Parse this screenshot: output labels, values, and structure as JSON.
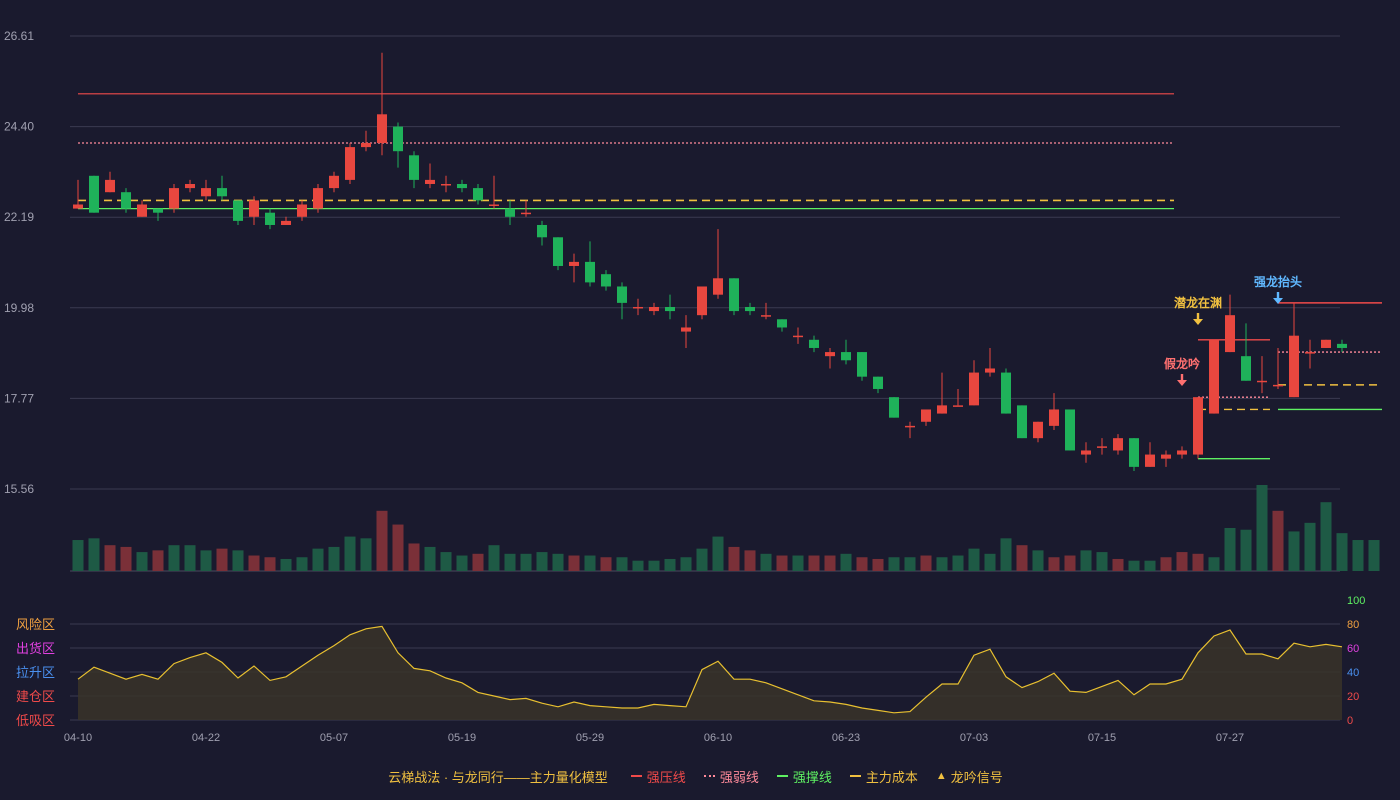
{
  "chart_data": {
    "type": "candlestick",
    "price_axis": {
      "ticks": [
        "26.61",
        "24.40",
        "22.19",
        "19.98",
        "17.77",
        "15.56"
      ],
      "ylim": [
        15.56,
        26.61
      ]
    },
    "x_ticks": [
      {
        "index": 0,
        "label": "04-10"
      },
      {
        "index": 8,
        "label": "04-22"
      },
      {
        "index": 16,
        "label": "05-07"
      },
      {
        "index": 24,
        "label": "05-19"
      },
      {
        "index": 32,
        "label": "05-29"
      },
      {
        "index": 40,
        "label": "06-10"
      },
      {
        "index": 48,
        "label": "06-23"
      },
      {
        "index": 56,
        "label": "07-03"
      },
      {
        "index": 64,
        "label": "07-15"
      },
      {
        "index": 72,
        "label": "07-27"
      }
    ],
    "candles": [
      [
        22.4,
        22.5,
        23.1,
        22.4
      ],
      [
        23.2,
        22.3,
        23.2,
        22.3
      ],
      [
        22.8,
        23.1,
        23.3,
        22.8
      ],
      [
        22.8,
        22.4,
        22.9,
        22.3
      ],
      [
        22.2,
        22.5,
        22.6,
        22.2
      ],
      [
        22.4,
        22.3,
        22.4,
        22.1
      ],
      [
        22.4,
        22.9,
        23.0,
        22.3
      ],
      [
        22.9,
        23.0,
        23.1,
        22.8
      ],
      [
        22.7,
        22.9,
        23.1,
        22.6
      ],
      [
        22.9,
        22.7,
        23.2,
        22.6
      ],
      [
        22.6,
        22.1,
        22.6,
        22.0
      ],
      [
        22.2,
        22.6,
        22.7,
        22.0
      ],
      [
        22.3,
        22.0,
        22.4,
        21.9
      ],
      [
        22.0,
        22.1,
        22.2,
        22.0
      ],
      [
        22.2,
        22.5,
        22.6,
        22.1
      ],
      [
        22.4,
        22.9,
        23.0,
        22.3
      ],
      [
        22.9,
        23.2,
        23.3,
        22.8
      ],
      [
        23.1,
        23.9,
        24.0,
        23.0
      ],
      [
        23.9,
        24.0,
        24.3,
        23.8
      ],
      [
        24.0,
        24.7,
        26.2,
        23.7
      ],
      [
        24.4,
        23.8,
        24.5,
        23.4
      ],
      [
        23.7,
        23.1,
        23.8,
        22.9
      ],
      [
        23.0,
        23.1,
        23.5,
        22.9
      ],
      [
        23.0,
        23.0,
        23.2,
        22.8
      ],
      [
        23.0,
        22.9,
        23.1,
        22.8
      ],
      [
        22.9,
        22.6,
        23.0,
        22.5
      ],
      [
        22.5,
        22.5,
        23.2,
        22.4
      ],
      [
        22.4,
        22.2,
        22.6,
        22.0
      ],
      [
        22.3,
        22.3,
        22.6,
        22.2
      ],
      [
        22.0,
        21.7,
        22.1,
        21.5
      ],
      [
        21.7,
        21.0,
        21.7,
        20.9
      ],
      [
        21.0,
        21.1,
        21.3,
        20.6
      ],
      [
        21.1,
        20.6,
        21.6,
        20.5
      ],
      [
        20.8,
        20.5,
        20.9,
        20.4
      ],
      [
        20.5,
        20.1,
        20.6,
        19.7
      ],
      [
        20.0,
        20.0,
        20.2,
        19.8
      ],
      [
        19.9,
        20.0,
        20.1,
        19.8
      ],
      [
        20.0,
        19.9,
        20.3,
        19.7
      ],
      [
        19.4,
        19.5,
        19.8,
        19.0
      ],
      [
        19.8,
        20.5,
        20.5,
        19.7
      ],
      [
        20.3,
        20.7,
        21.9,
        20.2
      ],
      [
        20.7,
        19.9,
        20.7,
        19.8
      ],
      [
        20.0,
        19.9,
        20.1,
        19.8
      ],
      [
        19.8,
        19.8,
        20.1,
        19.7
      ],
      [
        19.7,
        19.5,
        19.7,
        19.4
      ],
      [
        19.3,
        19.3,
        19.5,
        19.1
      ],
      [
        19.2,
        19.0,
        19.3,
        18.9
      ],
      [
        18.8,
        18.9,
        19.0,
        18.5
      ],
      [
        18.9,
        18.7,
        19.2,
        18.6
      ],
      [
        18.9,
        18.3,
        18.9,
        18.2
      ],
      [
        18.3,
        18.0,
        18.3,
        17.9
      ],
      [
        17.8,
        17.3,
        17.8,
        17.3
      ],
      [
        17.1,
        17.1,
        17.2,
        16.8
      ],
      [
        17.2,
        17.5,
        17.5,
        17.1
      ],
      [
        17.4,
        17.6,
        18.4,
        17.4
      ],
      [
        17.6,
        17.6,
        18.0,
        17.6
      ],
      [
        17.6,
        18.4,
        18.7,
        17.6
      ],
      [
        18.4,
        18.5,
        19.0,
        18.3
      ],
      [
        18.4,
        17.4,
        18.5,
        17.4
      ],
      [
        17.6,
        16.8,
        17.6,
        16.8
      ],
      [
        16.8,
        17.2,
        17.2,
        16.7
      ],
      [
        17.1,
        17.5,
        17.9,
        17.0
      ],
      [
        17.5,
        16.5,
        17.5,
        16.5
      ],
      [
        16.4,
        16.5,
        16.7,
        16.2
      ],
      [
        16.6,
        16.6,
        16.8,
        16.4
      ],
      [
        16.5,
        16.8,
        16.9,
        16.4
      ],
      [
        16.8,
        16.1,
        16.8,
        16.0
      ],
      [
        16.1,
        16.4,
        16.7,
        16.1
      ],
      [
        16.3,
        16.4,
        16.5,
        16.1
      ],
      [
        16.4,
        16.5,
        16.6,
        16.3
      ],
      [
        16.4,
        17.8,
        17.8,
        16.3
      ],
      [
        17.4,
        19.2,
        19.2,
        17.4
      ],
      [
        18.9,
        19.8,
        20.3,
        18.9
      ],
      [
        18.8,
        18.2,
        19.6,
        18.2
      ],
      [
        18.2,
        18.2,
        18.8,
        17.9
      ],
      [
        18.1,
        18.1,
        19.0,
        18.0
      ],
      [
        17.8,
        19.3,
        20.1,
        17.8
      ],
      [
        18.9,
        18.9,
        19.2,
        18.5
      ],
      [
        19.0,
        19.2,
        19.2,
        19.0
      ],
      [
        19.1,
        19.0,
        19.2,
        18.9
      ]
    ],
    "volume": [
      18,
      19,
      15,
      14,
      11,
      12,
      15,
      15,
      12,
      13,
      12,
      9,
      8,
      7,
      8,
      13,
      14,
      20,
      19,
      35,
      27,
      16,
      14,
      11,
      9,
      10,
      15,
      10,
      10,
      11,
      10,
      9,
      9,
      8,
      8,
      6,
      6,
      7,
      8,
      13,
      20,
      14,
      12,
      10,
      9,
      9,
      9,
      9,
      10,
      8,
      7,
      8,
      8,
      9,
      8,
      9,
      13,
      10,
      19,
      15,
      12,
      8,
      9,
      12,
      11,
      7,
      6,
      6,
      8,
      11,
      10,
      8,
      25,
      24,
      50,
      35,
      23,
      28,
      40,
      22,
      18,
      18
    ],
    "volume_up": [
      false,
      false,
      true,
      true,
      false,
      true,
      false,
      false,
      false,
      true,
      false,
      true,
      true,
      false,
      false,
      false,
      false,
      false,
      false,
      true,
      true,
      true,
      false,
      false,
      false,
      true,
      false,
      false,
      false,
      false,
      false,
      true,
      false,
      true,
      false,
      false,
      false,
      false,
      false,
      false,
      false,
      true,
      true,
      false,
      true,
      false,
      true,
      true,
      false,
      true,
      true,
      false,
      false,
      true,
      false,
      false,
      false,
      false,
      false,
      true,
      false,
      true,
      true,
      false,
      false,
      true,
      false,
      false,
      true,
      true,
      true,
      false,
      false,
      false,
      false,
      true,
      false,
      false,
      false,
      false,
      false,
      false
    ],
    "indicator": {
      "name": "龙吟",
      "ylim": [
        0,
        100
      ],
      "right_ticks": [
        "100",
        "80",
        "60",
        "40",
        "20",
        "0"
      ],
      "zones": [
        "风险区",
        "出货区",
        "拉升区",
        "建仓区",
        "低吸区"
      ],
      "values": [
        34,
        44,
        39,
        34,
        38,
        34,
        47,
        52,
        56,
        48,
        35,
        45,
        33,
        36,
        45,
        54,
        62,
        71,
        76,
        78,
        56,
        43,
        41,
        35,
        31,
        23,
        20,
        17,
        18,
        14,
        11,
        15,
        12,
        11,
        10,
        10,
        13,
        12,
        11,
        42,
        49,
        34,
        34,
        31,
        26,
        21,
        16,
        15,
        13,
        10,
        8,
        6,
        7,
        19,
        30,
        30,
        54,
        59,
        36,
        27,
        32,
        39,
        24,
        23,
        28,
        33,
        21,
        30,
        30,
        34,
        56,
        70,
        75,
        55,
        55,
        51,
        64,
        61,
        63,
        61
      ]
    },
    "lines": {
      "strong_pressure": {
        "label": "强压线",
        "value": 25.2,
        "from": 0,
        "to": 68,
        "color": "#f04a4a"
      },
      "weak_line": {
        "label": "强弱线",
        "value": 24.0,
        "from": 0,
        "to": 68,
        "color": "#ff8a9a"
      },
      "support_line": {
        "label": "强撑线",
        "value": 22.4,
        "from": 0,
        "to": 68,
        "color": "#5ef062"
      },
      "main_cost": {
        "label": "主力成本",
        "value": 22.6,
        "from": 0,
        "to": 68,
        "color": "#f0c040"
      }
    },
    "signals": [
      {
        "text": "假龙吟",
        "index": 69,
        "color": "#ff7070"
      },
      {
        "text": "潜龙在渊",
        "index": 70,
        "color": "#f0c040"
      },
      {
        "text": "强龙抬头",
        "index": 75,
        "color": "#60b8ff"
      }
    ],
    "legend": {
      "title": "云梯战法 · 与龙同行——主力量化模型",
      "items": [
        {
          "label": "强压线",
          "color": "#f04a4a",
          "style": "solid"
        },
        {
          "label": "强弱线",
          "color": "#ff8a9a",
          "style": "dotted"
        },
        {
          "label": "强撑线",
          "color": "#5ef062",
          "style": "solid"
        },
        {
          "label": "主力成本",
          "color": "#f0c040",
          "style": "dashed"
        },
        {
          "label": "龙吟信号",
          "color": "#f0c040",
          "style": "triangle"
        }
      ]
    },
    "colors": {
      "up": "#e8473f",
      "down": "#1fb25a",
      "bg": "#1a1a2e",
      "grid": "#3a3a50",
      "axis_text": "#a0a0b0",
      "indicator": "#e8c030"
    }
  }
}
